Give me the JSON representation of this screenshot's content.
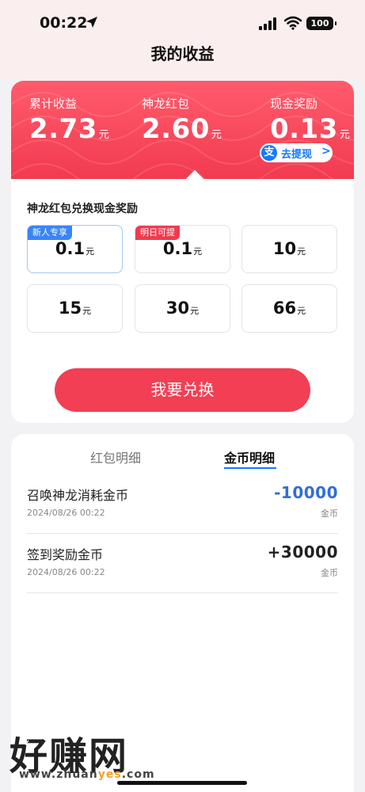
{
  "status": {
    "time": "00:22",
    "battery": "100"
  },
  "header": {
    "title": "我的收益"
  },
  "earnings": {
    "total": {
      "label": "累计收益",
      "value": "2.73",
      "unit": "元"
    },
    "dragon": {
      "label": "神龙红包",
      "value": "2.60",
      "unit": "元"
    },
    "cash": {
      "label": "现金奖励",
      "value": "0.13",
      "unit": "元"
    },
    "withdraw": {
      "icon": "支",
      "label": "去提现",
      "arrow": ">"
    }
  },
  "exchange": {
    "title": "神龙红包兑换现金奖励",
    "options": [
      {
        "amount": "0.1",
        "unit": "元",
        "tag": "新人专享"
      },
      {
        "amount": "0.1",
        "unit": "元",
        "tag": "明日可提"
      },
      {
        "amount": "10",
        "unit": "元"
      },
      {
        "amount": "15",
        "unit": "元"
      },
      {
        "amount": "30",
        "unit": "元"
      },
      {
        "amount": "66",
        "unit": "元"
      }
    ],
    "button": "我要兑换"
  },
  "details": {
    "tabs": [
      "红包明细",
      "金币明细"
    ],
    "active_tab": 1,
    "rows": [
      {
        "title": "召唤神龙消耗金币",
        "time": "2024/08/26 00:22",
        "amount": "-10000",
        "unit": "金币"
      },
      {
        "title": "签到奖励金币",
        "time": "2024/08/26 00:22",
        "amount": "+30000",
        "unit": "金币"
      }
    ]
  },
  "watermark": {
    "text": "好赚网",
    "url_a": "www.zhuan",
    "url_b": "yes",
    "url_c": ".com"
  },
  "colors": {
    "primary": "#f23f53",
    "blue": "#1677ff",
    "negative": "#2f6ed8"
  }
}
